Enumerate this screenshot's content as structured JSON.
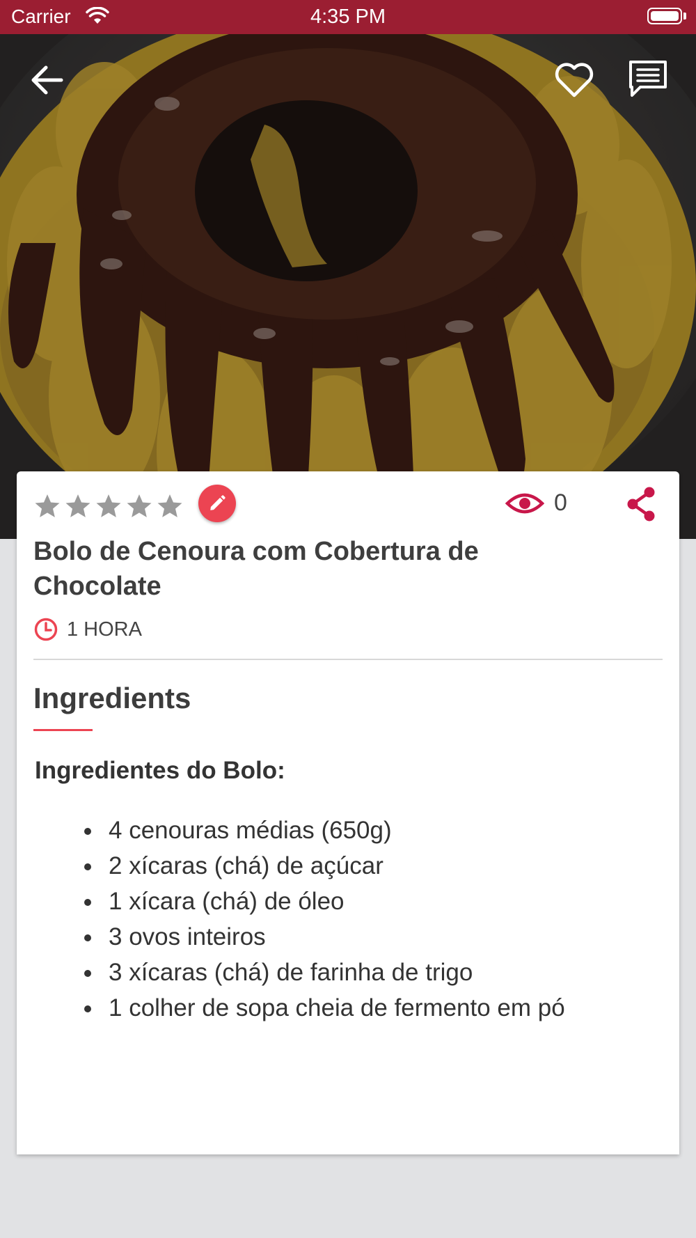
{
  "status_bar": {
    "carrier": "Carrier",
    "time": "4:35 PM"
  },
  "hero": {
    "image": "carrot cake with chocolate glaze",
    "back_icon": "arrow-left-icon",
    "favorite_icon": "heart-outline-icon",
    "comments_icon": "chat-bubble-icon"
  },
  "card": {
    "rating": 0,
    "rating_max": 5,
    "views": "0",
    "title": "Bolo de Cenoura com Cobertura de Chocolate",
    "time": "1 HORA",
    "section_title": "Ingredients",
    "sub_heading": "Ingredientes do Bolo:",
    "ingredients": [
      "4 cenouras médias (650g)",
      "2 xícaras (chá) de açúcar",
      "1 xícara (chá) de óleo",
      "3 ovos inteiros",
      "3 xícaras (chá) de farinha de trigo",
      "1 colher de sopa cheia de fermento em pó"
    ]
  },
  "colors": {
    "status_bar": "#9b1e32",
    "accent": "#ec4452",
    "icon_red": "#c8174a",
    "star_gray": "#9a9a9a",
    "background": "#e1e2e4"
  }
}
